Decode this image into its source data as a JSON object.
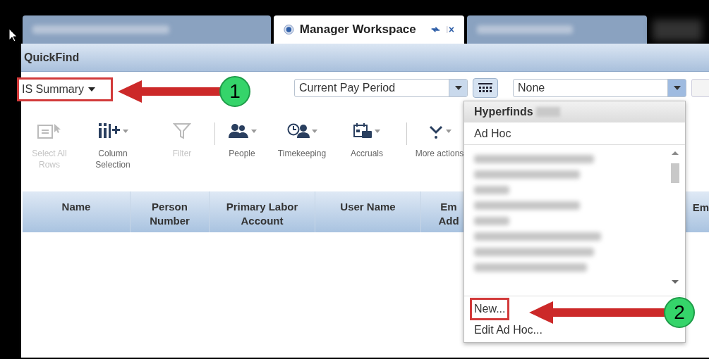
{
  "tabs": [
    {
      "kind": "blurred",
      "selected": false
    },
    {
      "kind": "named",
      "label": "Manager Workspace",
      "selected": true
    },
    {
      "kind": "blurred",
      "selected": false
    }
  ],
  "panel": {
    "title": "QuickFind"
  },
  "query_menu": {
    "label": "IS Summary"
  },
  "period_select": {
    "value": "Current Pay Period"
  },
  "hyperfind_select": {
    "value": "None",
    "expanded": true
  },
  "toolbar": [
    {
      "label": "Select All Rows",
      "kind": "select",
      "disabled": true,
      "has_menu": false
    },
    {
      "label": "Column Selection",
      "kind": "columns",
      "disabled": false,
      "has_menu": true
    },
    {
      "label": "Filter",
      "kind": "filter",
      "disabled": true,
      "has_menu": false
    },
    {
      "label": "People",
      "kind": "people",
      "disabled": false,
      "has_menu": true
    },
    {
      "label": "Timekeeping",
      "kind": "timekeeping",
      "disabled": false,
      "has_menu": true
    },
    {
      "label": "Accruals",
      "kind": "accruals",
      "disabled": false,
      "has_menu": true
    },
    {
      "label": "More actions",
      "kind": "more",
      "disabled": false,
      "has_menu": true
    }
  ],
  "table": {
    "columns": [
      "Name",
      "Person Number",
      "Primary Labor Account",
      "User Name",
      "Em Add"
    ],
    "right_column": "Em"
  },
  "dropdown": {
    "header": "Hyperfinds",
    "first_item": "Ad Hoc",
    "actions": [
      "New...",
      "Edit Ad Hoc..."
    ]
  },
  "annotations": [
    {
      "step": "1"
    },
    {
      "step": "2"
    }
  ]
}
